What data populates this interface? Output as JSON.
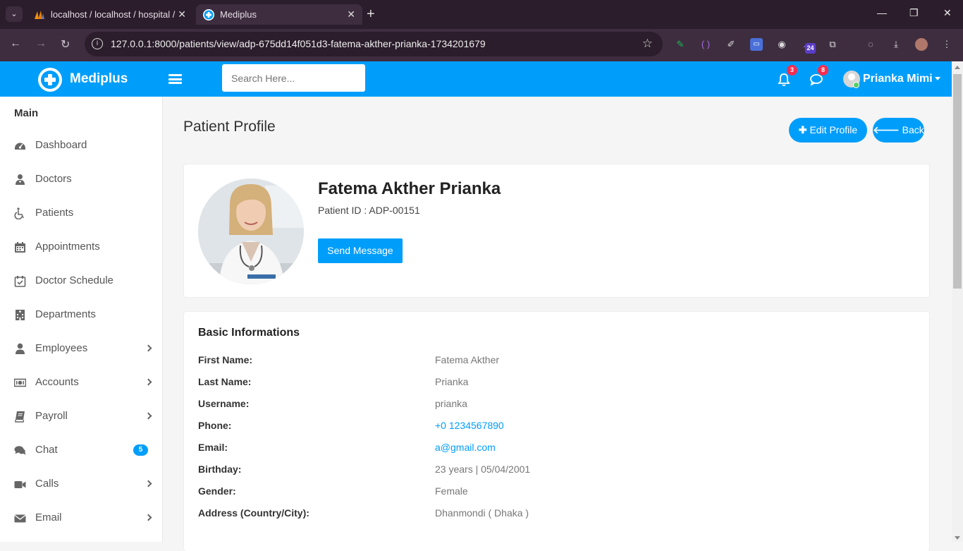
{
  "browser": {
    "tabs": [
      {
        "title": "localhost / localhost / hospital /",
        "active": false
      },
      {
        "title": "Mediplus",
        "active": true
      }
    ],
    "url": "127.0.0.1:8000/patients/view/adp-675dd14f051d3-fatema-akther-prianka-1734201679",
    "extension_badge": "24"
  },
  "header": {
    "brand": "Mediplus",
    "search_placeholder": "Search Here...",
    "notifications_count": "3",
    "messages_count": "8",
    "user_name": "Prianka Mimi",
    "accent_color": "#009efb"
  },
  "sidebar": {
    "title": "Main",
    "items": [
      {
        "label": "Dashboard",
        "icon": "dashboard-icon",
        "has_submenu": false
      },
      {
        "label": "Doctors",
        "icon": "doctor-icon",
        "has_submenu": false
      },
      {
        "label": "Patients",
        "icon": "wheelchair-icon",
        "has_submenu": false
      },
      {
        "label": "Appointments",
        "icon": "calendar-icon",
        "has_submenu": false
      },
      {
        "label": "Doctor Schedule",
        "icon": "calendar-check-icon",
        "has_submenu": false
      },
      {
        "label": "Departments",
        "icon": "hospital-icon",
        "has_submenu": false
      },
      {
        "label": "Employees",
        "icon": "user-icon",
        "has_submenu": true
      },
      {
        "label": "Accounts",
        "icon": "money-icon",
        "has_submenu": true
      },
      {
        "label": "Payroll",
        "icon": "book-icon",
        "has_submenu": true
      },
      {
        "label": "Chat",
        "icon": "comments-icon",
        "has_submenu": false,
        "badge": "5"
      },
      {
        "label": "Calls",
        "icon": "video-icon",
        "has_submenu": true
      },
      {
        "label": "Email",
        "icon": "envelope-icon",
        "has_submenu": true
      }
    ]
  },
  "page": {
    "title": "Patient Profile",
    "edit_label": "Edit Profile",
    "back_label": "Back"
  },
  "profile": {
    "name": "Fatema Akther Prianka",
    "patient_id": "Patient ID : ADP-00151",
    "send_message_label": "Send Message"
  },
  "basic_info": {
    "title": "Basic Informations",
    "rows": [
      {
        "label": "First Name:",
        "value": "Fatema Akther",
        "link": false
      },
      {
        "label": "Last Name:",
        "value": "Prianka",
        "link": false
      },
      {
        "label": "Username:",
        "value": "prianka",
        "link": false
      },
      {
        "label": "Phone:",
        "value": "+0 1234567890",
        "link": true
      },
      {
        "label": "Email:",
        "value": "a@gmail.com",
        "link": true
      },
      {
        "label": "Birthday:",
        "value": "23 years | 05/04/2001",
        "link": false
      },
      {
        "label": "Gender:",
        "value": "Female",
        "link": false
      },
      {
        "label": "Address (Country/City):",
        "value": "Dhanmondi ( Dhaka )",
        "link": false
      }
    ]
  }
}
